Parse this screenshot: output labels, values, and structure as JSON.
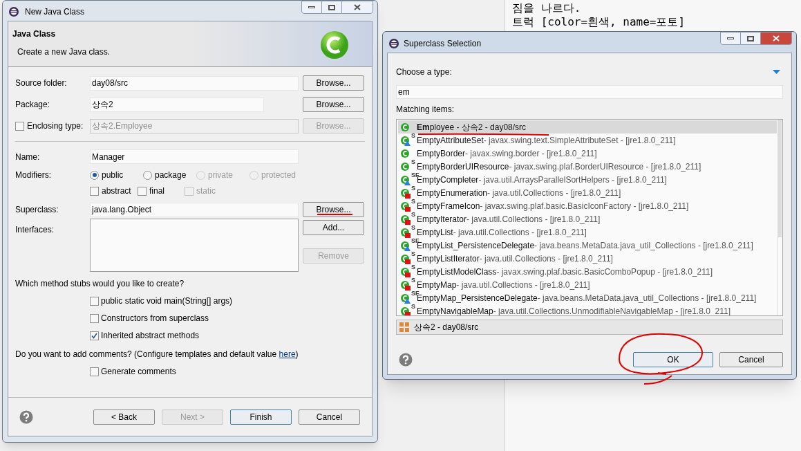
{
  "console": {
    "lines": [
      "짐을 나르다.",
      "트럭 [color=흰색, name=포토]"
    ]
  },
  "new_class": {
    "window": {
      "title": "New Java Class"
    },
    "header": {
      "title": "Java Class",
      "description": "Create a new Java class."
    },
    "source_folder": {
      "label": "Source folder:",
      "value": "day08/src",
      "button": "Browse..."
    },
    "package": {
      "label": "Package:",
      "value": "상속2",
      "button": "Browse..."
    },
    "enclosing": {
      "label": "Enclosing type:",
      "checked": false,
      "value": "상속2.Employee",
      "button": "Browse...",
      "disabled": true
    },
    "name": {
      "label": "Name:",
      "value": "Manager"
    },
    "modifiers": {
      "label": "Modifiers:",
      "radios": [
        {
          "label": "public",
          "selected": true,
          "disabled": false
        },
        {
          "label": "package",
          "selected": false,
          "disabled": false
        },
        {
          "label": "private",
          "selected": false,
          "disabled": true
        },
        {
          "label": "protected",
          "selected": false,
          "disabled": true
        }
      ],
      "checks": [
        {
          "label": "abstract",
          "checked": false,
          "disabled": false
        },
        {
          "label": "final",
          "checked": false,
          "disabled": false
        },
        {
          "label": "static",
          "checked": false,
          "disabled": true
        }
      ]
    },
    "superclass": {
      "label": "Superclass:",
      "value": "java.lang.Object",
      "button": "Browse..."
    },
    "interfaces": {
      "label": "Interfaces:",
      "buttons": [
        {
          "label": "Add...",
          "disabled": false
        },
        {
          "label": "Remove",
          "disabled": true
        }
      ]
    },
    "stubs": {
      "question": "Which method stubs would you like to create?",
      "options": [
        {
          "label": "public static void main(String[] args)",
          "checked": false
        },
        {
          "label": "Constructors from superclass",
          "checked": false
        },
        {
          "label": "Inherited abstract methods",
          "checked": true
        }
      ]
    },
    "comments": {
      "question": "Do you want to add comments? (Configure templates and default value ",
      "link": "here",
      "tail": ")",
      "option": {
        "label": "Generate comments",
        "checked": false
      }
    },
    "buttons": [
      {
        "label": "< Back",
        "disabled": false,
        "default": false
      },
      {
        "label": "Next >",
        "disabled": true,
        "default": false
      },
      {
        "label": "Finish",
        "disabled": false,
        "default": true
      },
      {
        "label": "Cancel",
        "disabled": false,
        "default": false
      }
    ]
  },
  "superclass_dialog": {
    "window": {
      "title": "Superclass Selection"
    },
    "prompt": "Choose a type:",
    "filter": "em",
    "list_label": "Matching items:",
    "items": [
      {
        "kind": "class",
        "name": "**Em**ployee - 상속2 - day08/src",
        "selected": true
      },
      {
        "kind": "default",
        "badge": "S",
        "name": "EmptyAttributeSet",
        "detail": " - javax.swing.text.SimpleAttributeSet - [jre1.8.0_211]",
        "selected": false
      },
      {
        "kind": "class",
        "name": "EmptyBorder",
        "detail": " - javax.swing.border - [jre1.8.0_211]",
        "selected": false
      },
      {
        "kind": "class",
        "badge": "S",
        "name": "EmptyBorderUIResource",
        "detail": " - javax.swing.plaf.BorderUIResource - [jre1.8.0_211]",
        "selected": false
      },
      {
        "kind": "default",
        "badge": "SF",
        "name": "EmptyCompleter",
        "detail": " - java.util.ArraysParallelSortHelpers - [jre1.8.0_211]",
        "selected": false
      },
      {
        "kind": "private",
        "badge": "S",
        "name": "EmptyEnumeration",
        "detail": " - java.util.Collections - [jre1.8.0_211]",
        "selected": false
      },
      {
        "kind": "private",
        "badge": "S",
        "name": "EmptyFrameIcon",
        "detail": " - javax.swing.plaf.basic.BasicIconFactory - [jre1.8.0_211]",
        "selected": false
      },
      {
        "kind": "private",
        "badge": "S",
        "name": "EmptyIterator",
        "detail": " - java.util.Collections - [jre1.8.0_211]",
        "selected": false
      },
      {
        "kind": "private",
        "badge": "S",
        "name": "EmptyList",
        "detail": " - java.util.Collections - [jre1.8.0_211]",
        "selected": false
      },
      {
        "kind": "default",
        "badge": "SF",
        "name": "EmptyList_PersistenceDelegate",
        "detail": " - java.beans.MetaData.java_util_Collections - [jre1.8.0_211]",
        "selected": false
      },
      {
        "kind": "private",
        "badge": "S",
        "name": "EmptyListIterator",
        "detail": " - java.util.Collections - [jre1.8.0_211]",
        "selected": false
      },
      {
        "kind": "private",
        "badge": "S",
        "name": "EmptyListModelClass",
        "detail": " - javax.swing.plaf.basic.BasicComboPopup - [jre1.8.0_211]",
        "selected": false
      },
      {
        "kind": "private",
        "badge": "S",
        "name": "EmptyMap",
        "detail": " - java.util.Collections - [jre1.8.0_211]",
        "selected": false
      },
      {
        "kind": "default",
        "badge": "SF",
        "name": "EmptyMap_PersistenceDelegate",
        "detail": " - java.beans.MetaData.java_util_Collections - [jre1.8.0_211]",
        "selected": false
      },
      {
        "kind": "private",
        "badge": "S",
        "name": "EmptyNavigableMap",
        "detail": " - java.util.Collections.UnmodifiableNavigableMap - [jre1.8.0_211]",
        "selected": false
      }
    ],
    "status": "상속2 - day08/src",
    "buttons": [
      {
        "label": "OK",
        "default": true
      },
      {
        "label": "Cancel",
        "default": false
      }
    ]
  }
}
